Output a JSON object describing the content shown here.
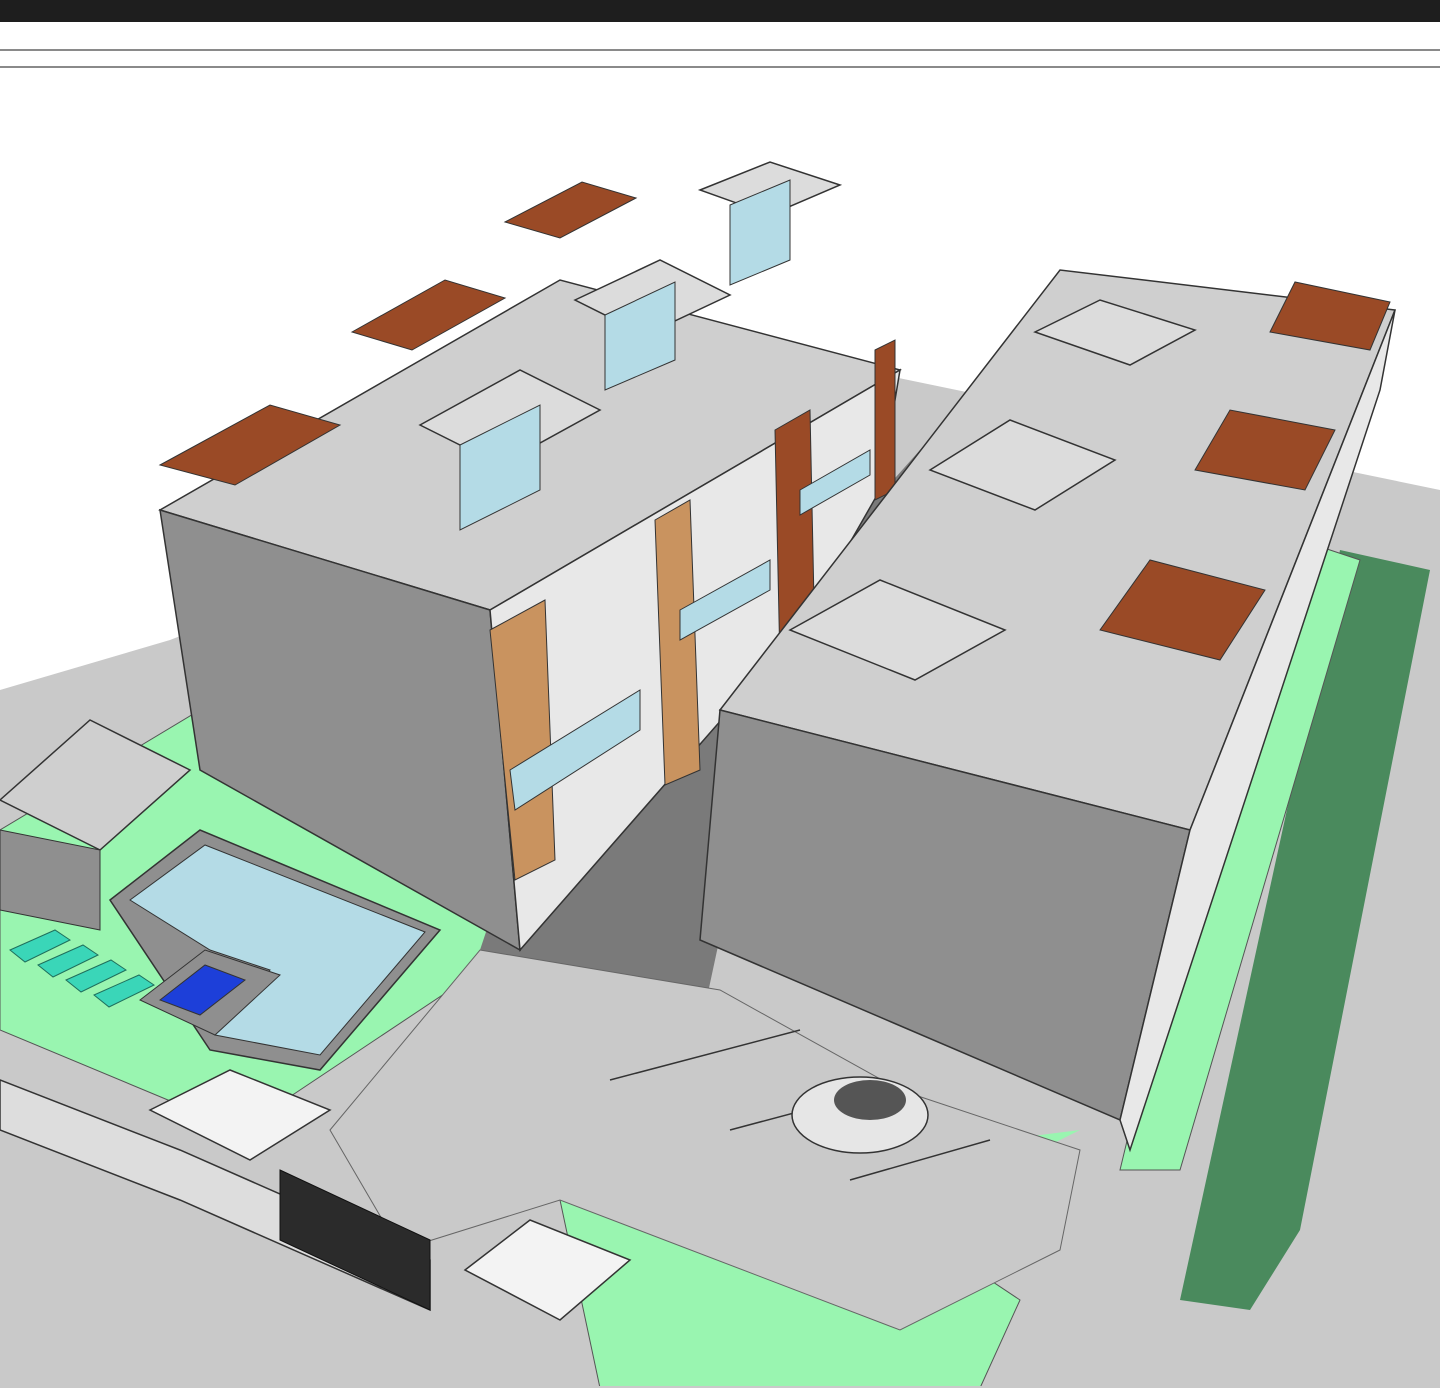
{
  "window": {
    "chrome_color": "#1e1e1e"
  },
  "viewport": {
    "content": "3d-site-model",
    "colors": {
      "lawn": "#99f5b0",
      "lawn_dark": "#4a8a5d",
      "pavement": "#7a7a7a",
      "pavement_light": "#c9c9c9",
      "wall": "#8f8f8f",
      "roof": "#cfcfcf",
      "wood_cladding": "#c9935f",
      "pergola": "#9a4a26",
      "pool_water": "#b4dbe6",
      "spa": "#1d3fd9",
      "lounger": "#3ad6b8"
    }
  }
}
